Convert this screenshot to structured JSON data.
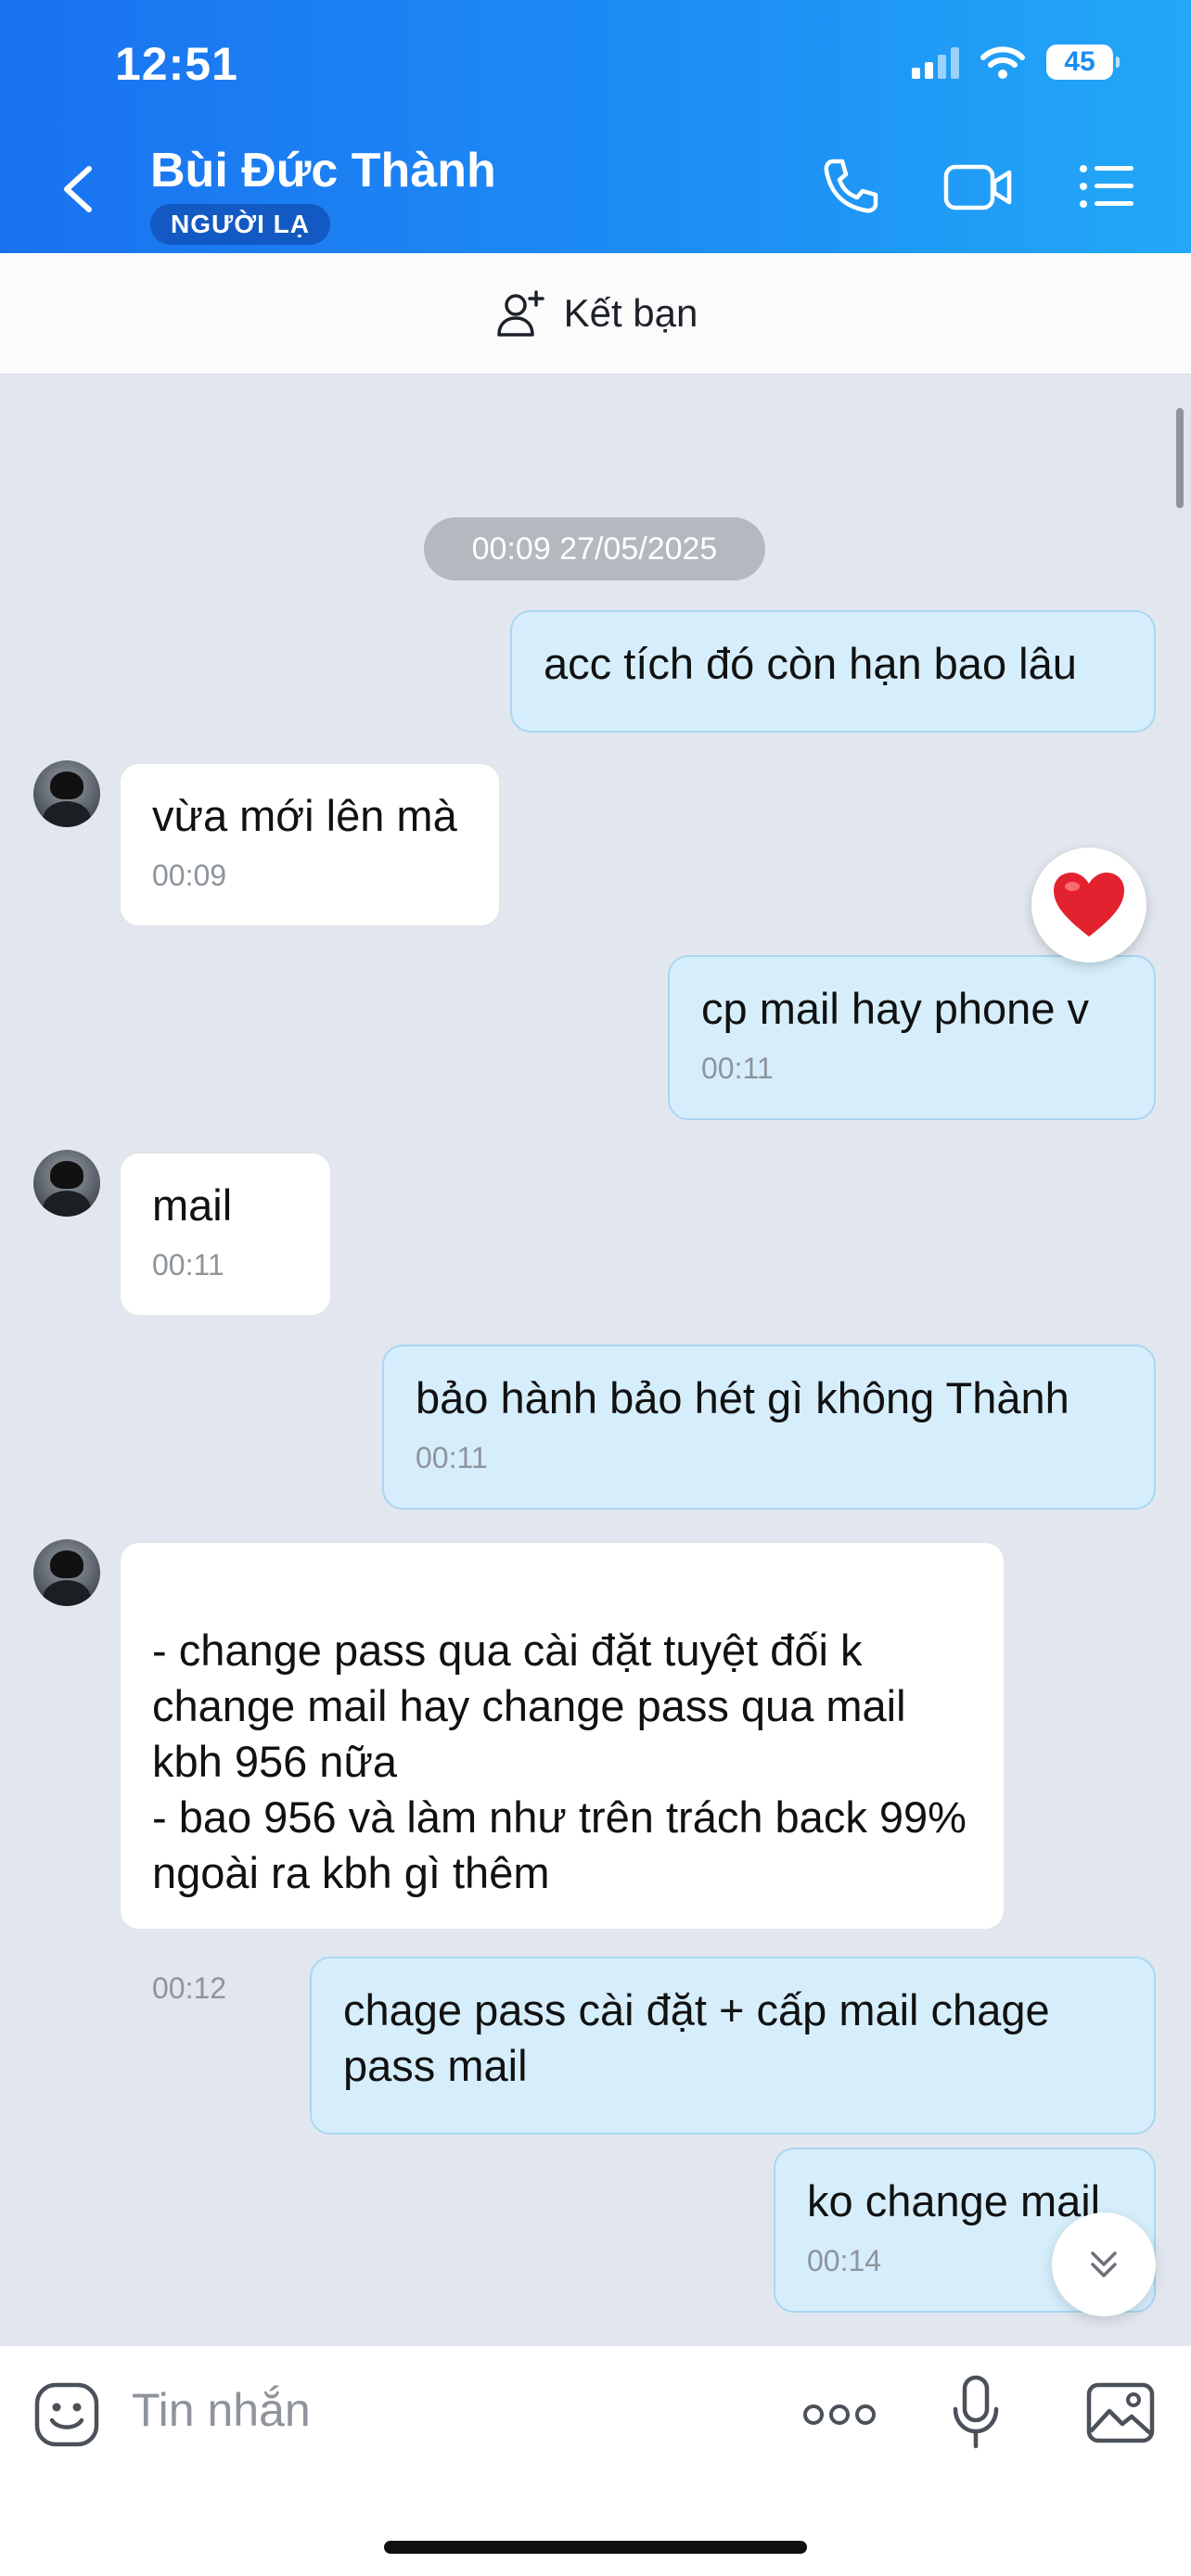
{
  "status_bar": {
    "time": "12:51",
    "battery": "45"
  },
  "header": {
    "contact_name": "Bùi Đức Thành",
    "badge": "NGƯỜI LẠ"
  },
  "friend_bar": {
    "label": "Kết bạn"
  },
  "chat": {
    "date_separator": "00:09 27/05/2025",
    "messages": [
      {
        "dir": "out",
        "text": "acc tích đó còn hạn bao lâu",
        "time": ""
      },
      {
        "dir": "in",
        "text": "vừa mới lên mà",
        "time": "00:09"
      },
      {
        "dir": "out",
        "text": "cp mail hay phone v",
        "time": "00:11",
        "reaction": "heart"
      },
      {
        "dir": "in",
        "text": "mail",
        "time": "00:11"
      },
      {
        "dir": "out",
        "text": "bảo hành bảo hét gì không Thành",
        "time": "00:11"
      },
      {
        "dir": "in",
        "text": "- change pass qua cài đặt tuyệt đối k change mail hay change pass qua mail kbh 956 nữa\n- bao 956 và làm như trên trách back 99% ngoài ra kbh gì thêm",
        "time": "00:12"
      },
      {
        "dir": "out",
        "text": "chage pass cài đặt + cấp mail chage pass mail",
        "time": ""
      },
      {
        "dir": "out",
        "text": "ko change mail",
        "time": "00:14"
      }
    ]
  },
  "input": {
    "placeholder": "Tin nhắn"
  },
  "colors": {
    "header_start": "#1a72f0",
    "header_end": "#22a8f7",
    "outgoing_bubble": "#d6eefc",
    "incoming_bubble": "#ffffff",
    "chat_bg": "#e2e7ef"
  },
  "icons": [
    "chevron-left-icon",
    "phone-icon",
    "video-icon",
    "menu-list-icon",
    "add-friend-icon",
    "heart-icon",
    "chevron-double-down-icon",
    "sticker-icon",
    "more-icon",
    "microphone-icon",
    "image-icon"
  ]
}
